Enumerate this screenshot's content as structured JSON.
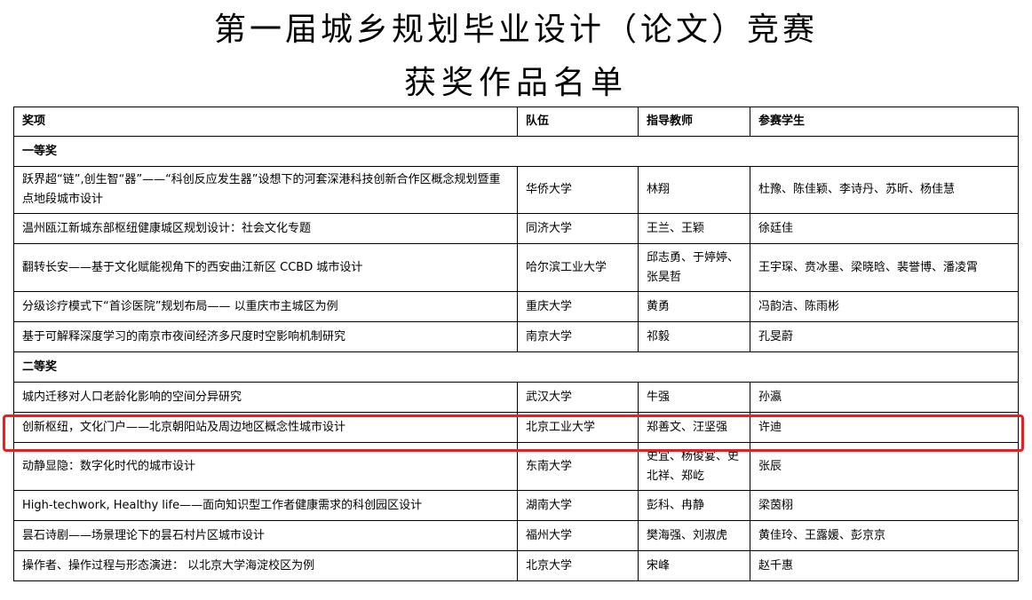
{
  "title_line1": "第一届城乡规划毕业设计（论文）竞赛",
  "title_line2": "获奖作品名单",
  "headers": {
    "award": "奖项",
    "team": "队伍",
    "advisor": "指导教师",
    "students": "参赛学生"
  },
  "sections": [
    {
      "label": "一等奖",
      "rows": [
        {
          "work": "跃界超“链”,创生智“器”——“科创反应发生器”设想下的河套深港科技创新合作区概念规划暨重点地段城市设计",
          "team": "华侨大学",
          "advisor": "林翔",
          "students": "杜豫、陈佳颖、李诗丹、苏昕、杨佳慧"
        },
        {
          "work": "温州瓯江新城东部枢纽健康城区规划设计：社会文化专题",
          "team": "同济大学",
          "advisor": "王兰、王颖",
          "students": "徐廷佳"
        },
        {
          "work": "翻转长安——基于文化赋能视角下的西安曲江新区 CCBD 城市设计",
          "team": "哈尔滨工业大学",
          "advisor": "邱志勇、于婷婷、张昊哲",
          "students": "王宇琛、贲冰墨、梁晓晗、裴誉博、潘凌霄"
        },
        {
          "work": "分级诊疗模式下“首诊医院”规划布局—— 以重庆市主城区为例",
          "team": "重庆大学",
          "advisor": "黄勇",
          "students": "冯韵洁、陈雨彬"
        },
        {
          "work": "基于可解释深度学习的南京市夜间经济多尺度时空影响机制研究",
          "team": "南京大学",
          "advisor": "祁毅",
          "students": "孔旻蔚"
        }
      ]
    },
    {
      "label": "二等奖",
      "rows": [
        {
          "work": "城内迁移对人口老龄化影响的空间分异研究",
          "team": "武汉大学",
          "advisor": "牛强",
          "students": "孙瀛"
        },
        {
          "work": "创新枢纽，文化门户——北京朝阳站及周边地区概念性城市设计",
          "team": "北京工业大学",
          "advisor": "郑善文、汪坚强",
          "students": "许迪"
        },
        {
          "work": "动静显隐：数字化时代的城市设计",
          "team": "东南大学",
          "advisor": "史宜、杨俊宴、史北祥、郑屹",
          "students": "张辰"
        },
        {
          "work": "High-techwork, Healthy life——面向知识型工作者健康需求的科创园区设计",
          "team": "湖南大学",
          "advisor": "彭科、冉静",
          "students": "梁茵栩"
        },
        {
          "work": "昙石诗剧——场景理论下的昙石村片区城市设计",
          "team": "福州大学",
          "advisor": "樊海强、刘淑虎",
          "students": "黄佳玲、王露媛、彭京京"
        },
        {
          "work": "操作者、操作过程与形态演进： 以北京大学海淀校区为例",
          "team": "北京大学",
          "advisor": "宋峰",
          "students": "赵千惠"
        }
      ]
    }
  ],
  "highlight_color": "#ee1c1c"
}
